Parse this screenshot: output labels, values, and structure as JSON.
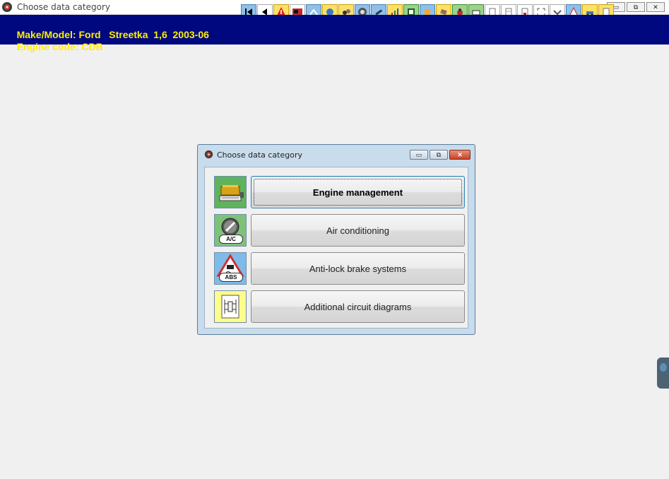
{
  "window": {
    "title": "Choose data category",
    "buttons": {
      "minimize": "▭",
      "restore": "⧉",
      "close": "✕"
    }
  },
  "toolbar": {
    "icons": [
      "first-icon",
      "back-icon",
      "warning-icon",
      "display-icon",
      "gauge-icon",
      "sensor-icon",
      "pump-icon",
      "wheel-icon",
      "tool-icon",
      "chart-icon",
      "book-icon",
      "tech-icon",
      "plug-icon",
      "bug-icon",
      "print-icon",
      "doc-icon",
      "doc2-icon",
      "doc3-icon",
      "expand-icon",
      "chevron-down-icon",
      "person-icon",
      "car-icon",
      "page-icon"
    ]
  },
  "vehicle": {
    "make_model_label": "Make/Model",
    "make_model_value": ": Ford   Streetka  1,6  2003-06",
    "engine_code_label": "Engine code",
    "engine_code_value": ": CDB"
  },
  "dialog": {
    "title": "Choose data category",
    "categories": [
      {
        "label": "Engine management",
        "icon": "engine-icon",
        "active": true
      },
      {
        "label": "Air conditioning",
        "icon": "ac-icon",
        "badge": "A/C"
      },
      {
        "label": "Anti-lock brake systems",
        "icon": "abs-icon",
        "badge": "ABS"
      },
      {
        "label": "Additional circuit diagrams",
        "icon": "circuit-icon"
      }
    ]
  },
  "colors": {
    "banner_bg": "#000880",
    "banner_text": "#ffee00",
    "active_border": "#3c7fb1"
  }
}
